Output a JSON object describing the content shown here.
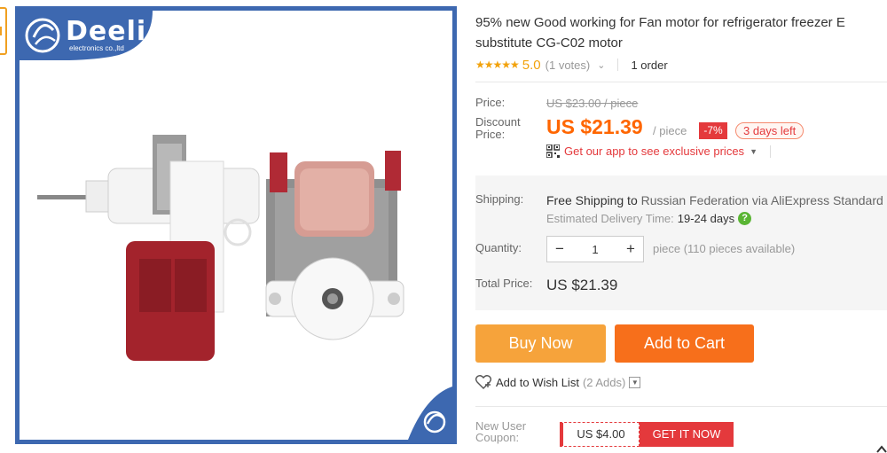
{
  "thumbnail": {
    "selected": true
  },
  "image": {
    "brand_name": "Deeli",
    "brand_tagline": "electronics co.,ltd"
  },
  "product": {
    "title_line1": "95% new Good working for Fan motor for refrigerator freezer E",
    "title_line2": "substitute CG-C02 motor",
    "rating_stars": "★★★★★",
    "rating_score": "5.0",
    "rating_votes": "(1 votes)",
    "orders": "1 order"
  },
  "price": {
    "price_label": "Price:",
    "original": "US $23.00 / piece",
    "discount_label_line1": "Discount",
    "discount_label_line2": "Price:",
    "discounted": "US $21.39",
    "per_piece": "/ piece",
    "off_badge": "-7%",
    "days_left": "3 days left",
    "app_promo": "Get our app to see exclusive prices"
  },
  "shipping": {
    "label": "Shipping:",
    "free": "Free Shipping",
    "to_text": " to ",
    "destination": "Russian Federation via AliExpress Standard",
    "eta_label": "Estimated Delivery Time:",
    "eta_days": "19-24 days"
  },
  "quantity": {
    "label": "Quantity:",
    "value": "1",
    "minus": "−",
    "plus": "+",
    "available": "piece (110 pieces available)"
  },
  "total": {
    "label": "Total Price:",
    "value": "US $21.39"
  },
  "actions": {
    "buy_now": "Buy Now",
    "add_to_cart": "Add to Cart"
  },
  "wishlist": {
    "label": "Add to Wish List",
    "count": "(2 Adds)"
  },
  "coupon": {
    "label_line1": "New User",
    "label_line2": "Coupon:",
    "amount": "US $4.00",
    "get_button": "GET IT NOW"
  },
  "colors": {
    "accent_orange": "#ff6600",
    "buy_now": "#f6a33b",
    "add_to_cart": "#f76f1b",
    "sale_red": "#e4393c",
    "star": "#f2a20b",
    "image_border": "#3d68b0"
  }
}
